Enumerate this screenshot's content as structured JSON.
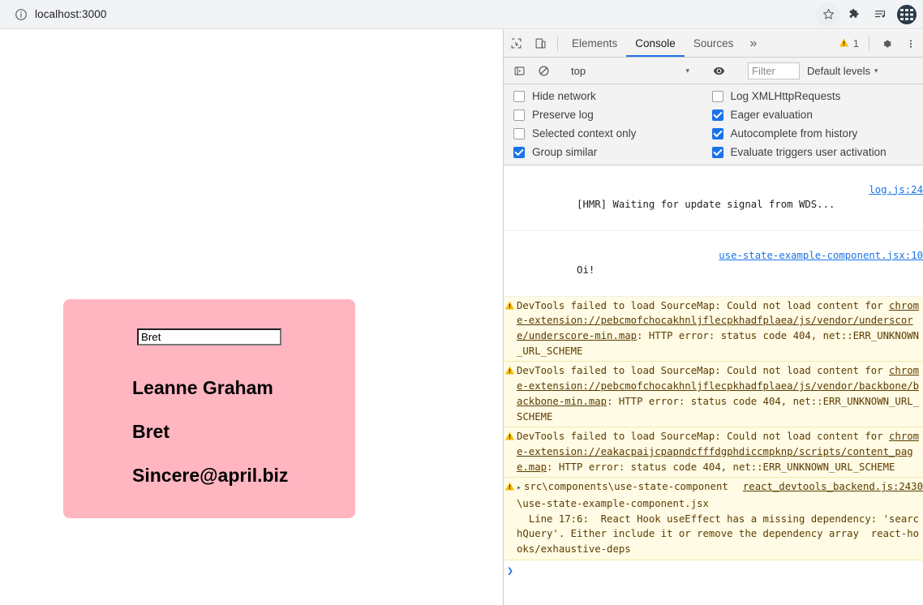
{
  "browser": {
    "url": "localhost:3000",
    "info_icon": "info-circle-icon",
    "actions": [
      {
        "name": "bookmark-star-icon",
        "label": "Bookmark this tab"
      },
      {
        "name": "extensions-puzzle-icon",
        "label": "Extensions"
      },
      {
        "name": "media-playlist-icon",
        "label": "Media control"
      },
      {
        "name": "profile-avatar",
        "label": "Profile"
      }
    ]
  },
  "page": {
    "card": {
      "input_value": "Bret",
      "input_placeholder": "",
      "lines": [
        "Leanne Graham",
        "Bret",
        "Sincere@april.biz"
      ],
      "background_color": "#ffb6c1"
    }
  },
  "devtools": {
    "tabbar": {
      "inspect_icon": "inspect-element-icon",
      "device_icon": "device-toolbar-icon",
      "tabs": [
        {
          "label": "Elements",
          "active": false
        },
        {
          "label": "Console",
          "active": true
        },
        {
          "label": "Sources",
          "active": false
        }
      ],
      "overflow_label": "»",
      "warning_icon": "warning-triangle-icon",
      "warning_count": "1",
      "settings_icon": "gear-icon",
      "more_icon": "kebab-menu-icon",
      "accent_color": "#1a73e8"
    },
    "console_toolbar": {
      "sidebar_icon": "console-sidebar-icon",
      "clear_icon": "clear-console-icon",
      "context_value": "top",
      "context_caret": "▾",
      "eye_icon": "live-expression-eye-icon",
      "filter_placeholder": "Filter",
      "filter_value": "",
      "levels_label": "Default levels",
      "levels_caret": "▾"
    },
    "settings": {
      "left": [
        {
          "label": "Hide network",
          "checked": false
        },
        {
          "label": "Preserve log",
          "checked": false
        },
        {
          "label": "Selected context only",
          "checked": false
        },
        {
          "label": "Group similar",
          "checked": true
        }
      ],
      "right": [
        {
          "label": "Log XMLHttpRequests",
          "checked": false
        },
        {
          "label": "Eager evaluation",
          "checked": true
        },
        {
          "label": "Autocomplete from history",
          "checked": true
        },
        {
          "label": "Evaluate triggers user activation",
          "checked": true
        }
      ]
    },
    "messages": [
      {
        "level": "log",
        "text": "[HMR] Waiting for update signal from WDS...",
        "source": "log.js:24"
      },
      {
        "level": "log",
        "text": "Oi!",
        "source": "use-state-example-component.jsx:10"
      },
      {
        "level": "warning",
        "text_before": "DevTools failed to load SourceMap: Could not load content for ",
        "link": "chrome-extension://pebcmofchocakhnljflecpkhadfplaea/js/vendor/underscore/underscore-min.map",
        "text_after": ": HTTP error: status code 404, net::ERR_UNKNOWN_URL_SCHEME",
        "source": ""
      },
      {
        "level": "warning",
        "text_before": "DevTools failed to load SourceMap: Could not load content for ",
        "link": "chrome-extension://pebcmofchocakhnljflecpkhadfplaea/js/vendor/backbone/backbone-min.map",
        "text_after": ": HTTP error: status code 404, net::ERR_UNKNOWN_URL_SCHEME",
        "source": ""
      },
      {
        "level": "warning",
        "text_before": "DevTools failed to load SourceMap: Could not load content for ",
        "link": "chrome-extension://eakacpaijcpapndcfffdgphdiccmpknp/scripts/content_page.map",
        "text_after": ": HTTP error: status code 404, net::ERR_UNKNOWN_URL_SCHEME",
        "source": ""
      },
      {
        "level": "warning",
        "expandable": true,
        "expander": "▸",
        "text_before": "src\\components\\use-state-component\\use-state-example-component.jsx\n  Line 17:6:  React Hook useEffect has a missing dependency: 'searchQuery'. Either include it or remove the dependency array  react-hooks/exhaustive-deps",
        "link": "",
        "text_after": "",
        "source": "react_devtools_backend.js:2430"
      }
    ],
    "prompt_caret": "❯"
  }
}
